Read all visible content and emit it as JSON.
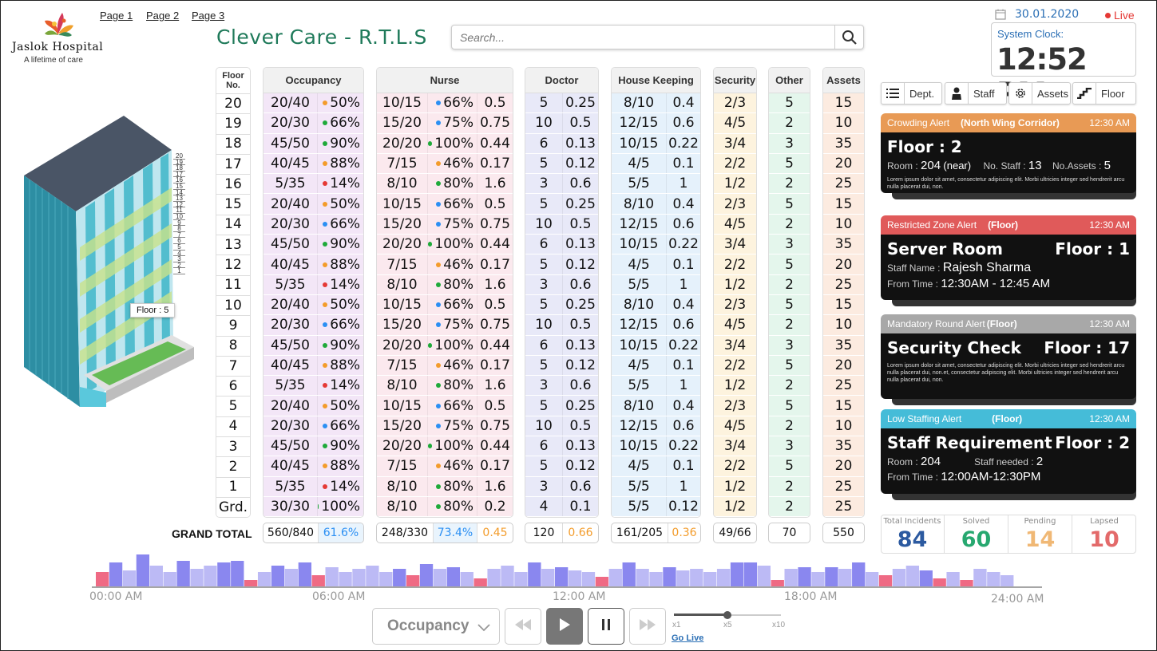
{
  "hospital": {
    "name": "Jaslok Hospital",
    "tagline": "A lifetime of care"
  },
  "nav": {
    "pages": [
      "Page 1",
      "Page 2",
      "Page 3"
    ]
  },
  "app": {
    "title": "Clever Care - R.T.L.S"
  },
  "search": {
    "placeholder": "Search..."
  },
  "header": {
    "date": "30.01.2020",
    "live_label": "Live",
    "clock_label": "System Clock:",
    "clock_time": "12:52 PM"
  },
  "building": {
    "floor_tag": "Floor : 5",
    "floor_labels": [
      "20",
      "19",
      "18",
      "17",
      "16",
      "15",
      "14",
      "13",
      "12",
      "11",
      "10",
      "9",
      "8",
      "7",
      "6",
      "5",
      "4",
      "3",
      "2",
      "1"
    ]
  },
  "table": {
    "headers": {
      "floor": "Floor No.",
      "occupancy": "Occupancy",
      "nurse": "Nurse",
      "doctor": "Doctor",
      "housekeeping": "House Keeping",
      "security": "Security",
      "other": "Other",
      "assets": "Assets"
    },
    "rows": [
      {
        "floor": "20",
        "occ": "20/40",
        "occ_pct": "50%",
        "occ_dot": "#f39c2b",
        "nurse": "10/15",
        "nurse_pct": "66%",
        "nurse_dot": "#2b8ff3",
        "nurse_r": "0.5",
        "doc": "5",
        "doc_r": "0.25",
        "hk": "8/10",
        "hk_r": "0.4",
        "sec": "2/3",
        "oth": "5",
        "ast": "15"
      },
      {
        "floor": "19",
        "occ": "20/30",
        "occ_pct": "66%",
        "occ_dot": "#1faa3a",
        "nurse": "15/20",
        "nurse_pct": "75%",
        "nurse_dot": "#2b8ff3",
        "nurse_r": "0.75",
        "doc": "10",
        "doc_r": "0.5",
        "hk": "12/15",
        "hk_r": "0.6",
        "sec": "4/5",
        "oth": "2",
        "ast": "10"
      },
      {
        "floor": "18",
        "occ": "45/50",
        "occ_pct": "90%",
        "occ_dot": "#1faa3a",
        "nurse": "20/20",
        "nurse_pct": "100%",
        "nurse_dot": "#1faa3a",
        "nurse_r": "0.44",
        "doc": "6",
        "doc_r": "0.13",
        "hk": "10/15",
        "hk_r": "0.22",
        "sec": "3/4",
        "oth": "3",
        "ast": "35"
      },
      {
        "floor": "17",
        "occ": "40/45",
        "occ_pct": "88%",
        "occ_dot": "#f39c2b",
        "nurse": "7/15",
        "nurse_pct": "46%",
        "nurse_dot": "#f39c2b",
        "nurse_r": "0.17",
        "doc": "5",
        "doc_r": "0.12",
        "hk": "4/5",
        "hk_r": "0.1",
        "sec": "2/2",
        "oth": "5",
        "ast": "20"
      },
      {
        "floor": "16",
        "occ": "5/35",
        "occ_pct": "14%",
        "occ_dot": "#e53935",
        "nurse": "8/10",
        "nurse_pct": "80%",
        "nurse_dot": "#1faa3a",
        "nurse_r": "1.6",
        "doc": "3",
        "doc_r": "0.6",
        "hk": "5/5",
        "hk_r": "1",
        "sec": "1/2",
        "oth": "2",
        "ast": "25"
      },
      {
        "floor": "15",
        "occ": "20/40",
        "occ_pct": "50%",
        "occ_dot": "#f39c2b",
        "nurse": "10/15",
        "nurse_pct": "66%",
        "nurse_dot": "#2b8ff3",
        "nurse_r": "0.5",
        "doc": "5",
        "doc_r": "0.25",
        "hk": "8/10",
        "hk_r": "0.4",
        "sec": "2/3",
        "oth": "5",
        "ast": "15"
      },
      {
        "floor": "14",
        "occ": "20/30",
        "occ_pct": "66%",
        "occ_dot": "#2b8ff3",
        "nurse": "15/20",
        "nurse_pct": "75%",
        "nurse_dot": "#2b8ff3",
        "nurse_r": "0.75",
        "doc": "10",
        "doc_r": "0.5",
        "hk": "12/15",
        "hk_r": "0.6",
        "sec": "4/5",
        "oth": "2",
        "ast": "10"
      },
      {
        "floor": "13",
        "occ": "45/50",
        "occ_pct": "90%",
        "occ_dot": "#1faa3a",
        "nurse": "20/20",
        "nurse_pct": "100%",
        "nurse_dot": "#1faa3a",
        "nurse_r": "0.44",
        "doc": "6",
        "doc_r": "0.13",
        "hk": "10/15",
        "hk_r": "0.22",
        "sec": "3/4",
        "oth": "3",
        "ast": "35"
      },
      {
        "floor": "12",
        "occ": "40/45",
        "occ_pct": "88%",
        "occ_dot": "#f39c2b",
        "nurse": "7/15",
        "nurse_pct": "46%",
        "nurse_dot": "#f39c2b",
        "nurse_r": "0.17",
        "doc": "5",
        "doc_r": "0.12",
        "hk": "4/5",
        "hk_r": "0.1",
        "sec": "2/2",
        "oth": "5",
        "ast": "20"
      },
      {
        "floor": "11",
        "occ": "5/35",
        "occ_pct": "14%",
        "occ_dot": "#e53935",
        "nurse": "8/10",
        "nurse_pct": "80%",
        "nurse_dot": "#1faa3a",
        "nurse_r": "1.6",
        "doc": "3",
        "doc_r": "0.6",
        "hk": "5/5",
        "hk_r": "1",
        "sec": "1/2",
        "oth": "2",
        "ast": "25"
      },
      {
        "floor": "10",
        "occ": "20/40",
        "occ_pct": "50%",
        "occ_dot": "#f39c2b",
        "nurse": "10/15",
        "nurse_pct": "66%",
        "nurse_dot": "#2b8ff3",
        "nurse_r": "0.5",
        "doc": "5",
        "doc_r": "0.25",
        "hk": "8/10",
        "hk_r": "0.4",
        "sec": "2/3",
        "oth": "5",
        "ast": "15"
      },
      {
        "floor": "9",
        "occ": "20/30",
        "occ_pct": "66%",
        "occ_dot": "#2b8ff3",
        "nurse": "15/20",
        "nurse_pct": "75%",
        "nurse_dot": "#2b8ff3",
        "nurse_r": "0.75",
        "doc": "10",
        "doc_r": "0.5",
        "hk": "12/15",
        "hk_r": "0.6",
        "sec": "4/5",
        "oth": "2",
        "ast": "10"
      },
      {
        "floor": "8",
        "occ": "45/50",
        "occ_pct": "90%",
        "occ_dot": "#1faa3a",
        "nurse": "20/20",
        "nurse_pct": "100%",
        "nurse_dot": "#1faa3a",
        "nurse_r": "0.44",
        "doc": "6",
        "doc_r": "0.13",
        "hk": "10/15",
        "hk_r": "0.22",
        "sec": "3/4",
        "oth": "3",
        "ast": "35"
      },
      {
        "floor": "7",
        "occ": "40/45",
        "occ_pct": "88%",
        "occ_dot": "#f39c2b",
        "nurse": "7/15",
        "nurse_pct": "46%",
        "nurse_dot": "#f39c2b",
        "nurse_r": "0.17",
        "doc": "5",
        "doc_r": "0.12",
        "hk": "4/5",
        "hk_r": "0.1",
        "sec": "2/2",
        "oth": "5",
        "ast": "20"
      },
      {
        "floor": "6",
        "occ": "5/35",
        "occ_pct": "14%",
        "occ_dot": "#e53935",
        "nurse": "8/10",
        "nurse_pct": "80%",
        "nurse_dot": "#1faa3a",
        "nurse_r": "1.6",
        "doc": "3",
        "doc_r": "0.6",
        "hk": "5/5",
        "hk_r": "1",
        "sec": "1/2",
        "oth": "2",
        "ast": "25"
      },
      {
        "floor": "5",
        "occ": "20/40",
        "occ_pct": "50%",
        "occ_dot": "#f39c2b",
        "nurse": "10/15",
        "nurse_pct": "66%",
        "nurse_dot": "#2b8ff3",
        "nurse_r": "0.5",
        "doc": "5",
        "doc_r": "0.25",
        "hk": "8/10",
        "hk_r": "0.4",
        "sec": "2/3",
        "oth": "5",
        "ast": "15"
      },
      {
        "floor": "4",
        "occ": "20/30",
        "occ_pct": "66%",
        "occ_dot": "#2b8ff3",
        "nurse": "15/20",
        "nurse_pct": "75%",
        "nurse_dot": "#2b8ff3",
        "nurse_r": "0.75",
        "doc": "10",
        "doc_r": "0.5",
        "hk": "12/15",
        "hk_r": "0.6",
        "sec": "4/5",
        "oth": "2",
        "ast": "10"
      },
      {
        "floor": "3",
        "occ": "45/50",
        "occ_pct": "90%",
        "occ_dot": "#1faa3a",
        "nurse": "20/20",
        "nurse_pct": "100%",
        "nurse_dot": "#1faa3a",
        "nurse_r": "0.44",
        "doc": "6",
        "doc_r": "0.13",
        "hk": "10/15",
        "hk_r": "0.22",
        "sec": "3/4",
        "oth": "3",
        "ast": "35"
      },
      {
        "floor": "2",
        "occ": "40/45",
        "occ_pct": "88%",
        "occ_dot": "#f39c2b",
        "nurse": "7/15",
        "nurse_pct": "46%",
        "nurse_dot": "#f39c2b",
        "nurse_r": "0.17",
        "doc": "5",
        "doc_r": "0.12",
        "hk": "4/5",
        "hk_r": "0.1",
        "sec": "2/2",
        "oth": "5",
        "ast": "20"
      },
      {
        "floor": "1",
        "occ": "5/35",
        "occ_pct": "14%",
        "occ_dot": "#e53935",
        "nurse": "8/10",
        "nurse_pct": "80%",
        "nurse_dot": "#1faa3a",
        "nurse_r": "1.6",
        "doc": "3",
        "doc_r": "0.6",
        "hk": "5/5",
        "hk_r": "1",
        "sec": "1/2",
        "oth": "2",
        "ast": "25"
      },
      {
        "floor": "Grd.",
        "occ": "30/30",
        "occ_pct": "100%",
        "occ_dot": "#1faa3a",
        "nurse": "8/10",
        "nurse_pct": "80%",
        "nurse_dot": "#1faa3a",
        "nurse_r": "0.2",
        "doc": "4",
        "doc_r": "0.1",
        "hk": "5/5",
        "hk_r": "0.12",
        "sec": "1/2",
        "oth": "2",
        "ast": "25"
      }
    ],
    "totals": {
      "label": "GRAND TOTAL",
      "occ": "560/840",
      "occ_pct": "61.6%",
      "nurse": "248/330",
      "nurse_pct": "73.4%",
      "nurse_r": "0.45",
      "doc": "120",
      "doc_r": "0.66",
      "hk": "161/205",
      "hk_r": "0.36",
      "sec": "49/66",
      "oth": "70",
      "ast": "550"
    }
  },
  "filters": {
    "dept": "Dept.",
    "staff": "Staff",
    "assets": "Assets",
    "floor": "Floor"
  },
  "alerts": [
    {
      "type": "Crowding Alert",
      "scope": "(North Wing Corridor)",
      "time": "12:30 AM",
      "title": "Floor : 2",
      "room_label": "Room :",
      "room": "204",
      "room_note": "(near)",
      "staff_label": "No. Staff :",
      "staff": "13",
      "assets_label": "No.Assets :",
      "assets": "5",
      "desc": "Lorem ipsum dolor sit amet, consectetur adipiscing elit. Morbi ultricies integer sed hendrerit arcu nulla placerat dui, non."
    },
    {
      "type": "Restricted Zone Alert",
      "scope": "(Floor)",
      "time": "12:30 AM",
      "title": "Server Room",
      "floor": "Floor : 1",
      "staff_label": "Staff Name :",
      "staff": "Rajesh Sharma",
      "from_label": "From Time :",
      "from": "12:30AM - 12:45 AM"
    },
    {
      "type": "Mandatory Round Alert",
      "scope": "(Floor)",
      "time": "12:30 AM",
      "title": "Security Check",
      "floor": "Floor : 17",
      "desc": "Lorem ipsum dolor sit amet, consectetur adipiscing elit. Morbi ultricies integer sed hendrerit arcu nulla placerat dui, non.et, consectetur adipiscing elit. Morbi ultricies integer sed hendrerit arcu nulla placerat dui, non."
    },
    {
      "type": "Low Staffing Alert",
      "scope": "(Floor)",
      "time": "12:30 AM",
      "title": "Staff Requirement",
      "floor": "Floor : 2",
      "room_label": "Room :",
      "room": "204",
      "needed_label": "Staff needed :",
      "needed": "2",
      "from_label": "From Time :",
      "from": "12:00AM-12:30PM"
    }
  ],
  "stats": [
    {
      "label": "Total Incidents",
      "value": "84",
      "color": "#2c5aa0"
    },
    {
      "label": "Solved",
      "value": "60",
      "color": "#27a870"
    },
    {
      "label": "Pending",
      "value": "14",
      "color": "#f0b875"
    },
    {
      "label": "Lapsed",
      "value": "10",
      "color": "#e36a6a"
    }
  ],
  "timeline": {
    "labels": [
      "00:00 AM",
      "06:00 AM",
      "12:00 AM",
      "18:00 AM",
      "24:00 AM"
    ],
    "bar_levels": [
      0.45,
      0.75,
      0.5,
      1,
      0.65,
      0.45,
      0.8,
      0.55,
      0.65,
      0.75,
      0.8,
      0.2,
      0.45,
      0.65,
      0.55,
      0.75,
      0.35,
      0.6,
      0.45,
      0.55,
      0.65,
      0.45,
      0.55,
      0.35,
      0.7,
      0.55,
      0.6,
      0.45,
      0.25,
      0.55,
      0.65,
      0.45,
      0.75,
      0.55,
      0.6,
      0.5,
      0.45,
      0.3,
      0.55,
      0.75,
      0.55,
      0.45,
      0.6,
      0.5,
      0.55,
      0.45,
      0.55,
      0.75,
      0.75,
      0.65,
      0.2,
      0.55,
      0.6,
      0.45,
      0.6,
      0.55,
      0.75,
      0.45,
      0.35,
      0.55,
      0.65,
      0.5,
      0.25,
      0.45,
      0.2,
      0.55,
      0.45,
      0.35
    ],
    "bar_kinds": [
      "r",
      "d",
      "l",
      "d",
      "l",
      "l",
      "d",
      "l",
      "l",
      "d",
      "d",
      "r",
      "l",
      "d",
      "l",
      "d",
      "r",
      "l",
      "l",
      "l",
      "l",
      "l",
      "d",
      "r",
      "d",
      "l",
      "d",
      "l",
      "r",
      "l",
      "l",
      "l",
      "d",
      "l",
      "d",
      "l",
      "l",
      "r",
      "l",
      "d",
      "l",
      "l",
      "d",
      "l",
      "l",
      "l",
      "l",
      "d",
      "d",
      "l",
      "r",
      "l",
      "d",
      "l",
      "d",
      "l",
      "d",
      "l",
      "r",
      "l",
      "l",
      "d",
      "r",
      "l",
      "r",
      "l",
      "l",
      "l"
    ]
  },
  "controls": {
    "select": "Occupancy",
    "speeds": [
      "x1",
      "x5",
      "x10"
    ],
    "speed_level": 0.5,
    "go_live": "Go Live"
  }
}
